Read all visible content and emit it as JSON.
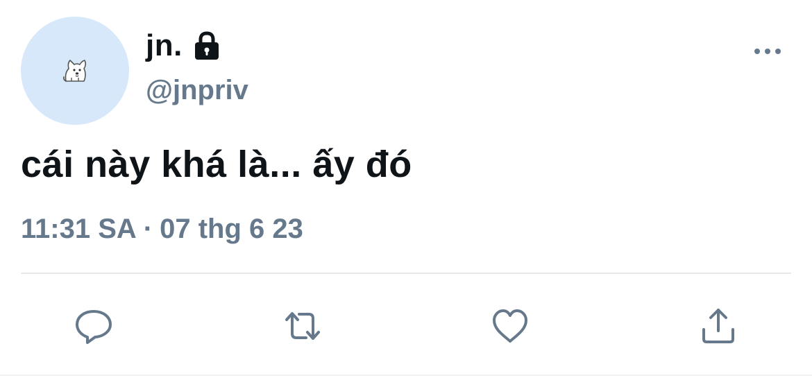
{
  "user": {
    "display_name": "jn.",
    "handle": "@jnpriv",
    "protected_icon": "lock-icon",
    "avatar_icon": "dog-icon"
  },
  "tweet": {
    "text": "cái này khá là... ấy đó",
    "time": "11:31 SA",
    "separator": "·",
    "date": "07 thg 6 23"
  },
  "header": {
    "more_icon": "more-horizontal-icon"
  },
  "actions": [
    {
      "name": "reply",
      "icon": "reply-icon"
    },
    {
      "name": "retweet",
      "icon": "retweet-icon"
    },
    {
      "name": "like",
      "icon": "heart-icon"
    },
    {
      "name": "share",
      "icon": "share-icon"
    }
  ],
  "colors": {
    "text_primary": "#0f1419",
    "text_secondary": "#66798c",
    "avatar_bg": "#d7e8fb",
    "divider": "#e6e9ec",
    "icon": "#66798c"
  }
}
